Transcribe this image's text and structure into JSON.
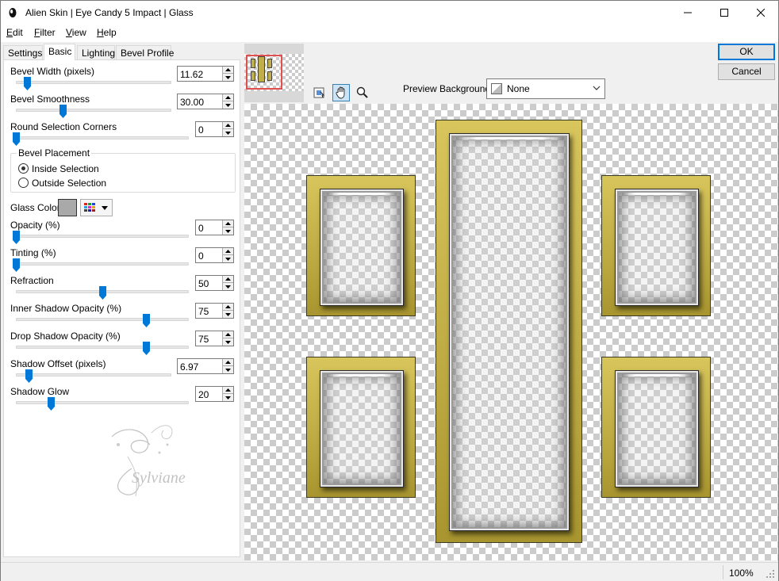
{
  "window": {
    "title": "Alien Skin | Eye Candy 5 Impact | Glass",
    "controls": [
      "minimize-icon",
      "maximize-icon",
      "close-icon"
    ]
  },
  "menu": [
    {
      "label": "Edit",
      "mnemonic": "E",
      "rest": "dit"
    },
    {
      "label": "Filter",
      "mnemonic": "F",
      "rest": "ilter"
    },
    {
      "label": "View",
      "mnemonic": "V",
      "rest": "iew"
    },
    {
      "label": "Help",
      "mnemonic": "H",
      "rest": "elp"
    }
  ],
  "tabs": [
    "Settings",
    "Basic",
    "Lighting",
    "Bevel Profile"
  ],
  "active_tab": "Basic",
  "controls": {
    "bevel_width": {
      "label": "Bevel Width (pixels)",
      "value": "11.62",
      "slider": 0.07
    },
    "bevel_smoothness": {
      "label": "Bevel Smoothness",
      "value": "30.00",
      "slider": 0.3
    },
    "round_corners": {
      "label": "Round Selection Corners",
      "value": "0",
      "slider": 0.0
    },
    "bevel_placement": {
      "legend": "Bevel Placement",
      "options": [
        "Inside Selection",
        "Outside Selection"
      ],
      "selected": "Inside Selection"
    },
    "glass_color": {
      "label": "Glass Color",
      "swatch": "#a9a9a9"
    },
    "opacity": {
      "label": "Opacity (%)",
      "value": "0",
      "slider": 0.0
    },
    "tinting": {
      "label": "Tinting (%)",
      "value": "0",
      "slider": 0.0
    },
    "refraction": {
      "label": "Refraction",
      "value": "50",
      "slider": 0.5
    },
    "inner_shadow_opacity": {
      "label": "Inner Shadow Opacity (%)",
      "value": "75",
      "slider": 0.75
    },
    "drop_shadow_opacity": {
      "label": "Drop Shadow Opacity (%)",
      "value": "75",
      "slider": 0.75
    },
    "shadow_offset": {
      "label": "Shadow Offset (pixels)",
      "value": "6.97",
      "slider": 0.08
    },
    "shadow_glow": {
      "label": "Shadow Glow",
      "value": "20",
      "slider": 0.2
    }
  },
  "buttons": {
    "ok": "OK",
    "cancel": "Cancel"
  },
  "preview_background": {
    "label": "Preview Background:",
    "value": "None"
  },
  "toolbar_icons": [
    "navigate-icon",
    "pan-hand-icon",
    "zoom-icon"
  ],
  "watermark": "Sylviane",
  "status": {
    "zoom": "100%"
  },
  "colors": {
    "accent": "#0078d7",
    "frame_gold": "#c9b54a",
    "slider_thumb": "#0078d7"
  }
}
